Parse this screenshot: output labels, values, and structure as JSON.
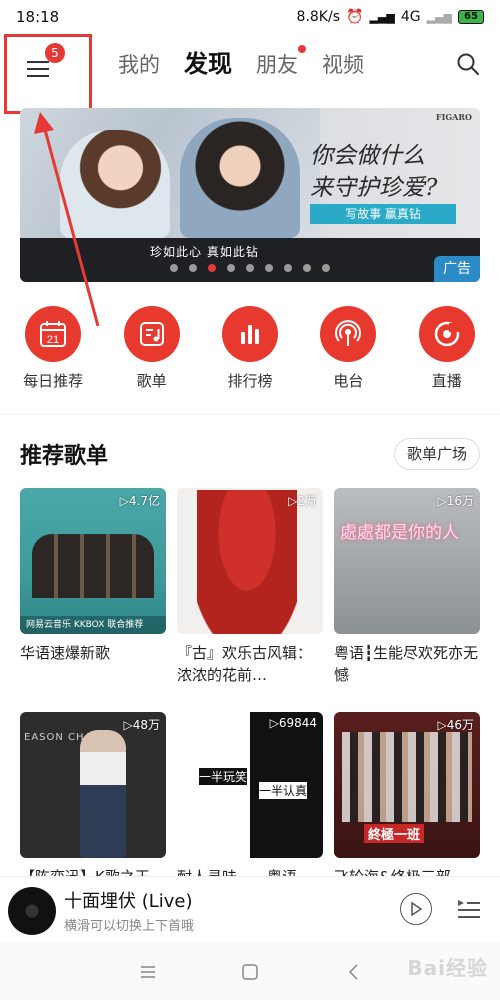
{
  "status": {
    "time": "18:18",
    "speed": "8.8K/s",
    "network": "4G",
    "battery": "65"
  },
  "header": {
    "menu_badge": "5",
    "tabs": [
      {
        "label": "我的"
      },
      {
        "label": "发现"
      },
      {
        "label": "朋友"
      },
      {
        "label": "视频"
      }
    ]
  },
  "banner": {
    "brand": "FIGARO",
    "headline_line1": "你会做什么",
    "headline_line2": "来守护珍爱?",
    "cta": "写故事 赢真钻",
    "slogan": "珍如此心 真如此钻",
    "ad_label": "广告",
    "active_dot": 2,
    "dot_count": 9
  },
  "quick": [
    {
      "label": "每日推荐",
      "icon": "calendar-icon",
      "day": "21"
    },
    {
      "label": "歌单",
      "icon": "playlist-icon"
    },
    {
      "label": "排行榜",
      "icon": "chart-icon"
    },
    {
      "label": "电台",
      "icon": "radio-icon"
    },
    {
      "label": "直播",
      "icon": "live-icon"
    }
  ],
  "section": {
    "title": "推荐歌单",
    "more": "歌单广场"
  },
  "playlists": [
    {
      "title": "华语速爆新歌",
      "plays": "▷4.7亿",
      "cover_logo": "网易云音乐 KKBOX 联合推荐"
    },
    {
      "title": "『古』欢乐古风辑：浓浓的花前…",
      "plays": "▷2万"
    },
    {
      "title": "粤语┇生能尽欢死亦无憾",
      "plays": "▷16万",
      "cover_text": "處處都是你的人"
    },
    {
      "title": "【陈奕迅】K歌之王",
      "plays": "▷48万",
      "cover_text": "EASON CHAN"
    },
    {
      "title": "耐人寻味——粤语",
      "plays": "▷69844",
      "cover_text_1": "一半玩笑",
      "cover_text_2": "一半认真"
    },
    {
      "title": "飞轮海&终极三部",
      "plays": "▷46万",
      "cover_text": "終極一班"
    }
  ],
  "player": {
    "title": "十面埋伏 (Live)",
    "subtitle": "横滑可以切换上下首哦"
  },
  "watermark": "Bai经验",
  "colors": {
    "accent": "#e8392f",
    "annotation": "#e53935"
  }
}
